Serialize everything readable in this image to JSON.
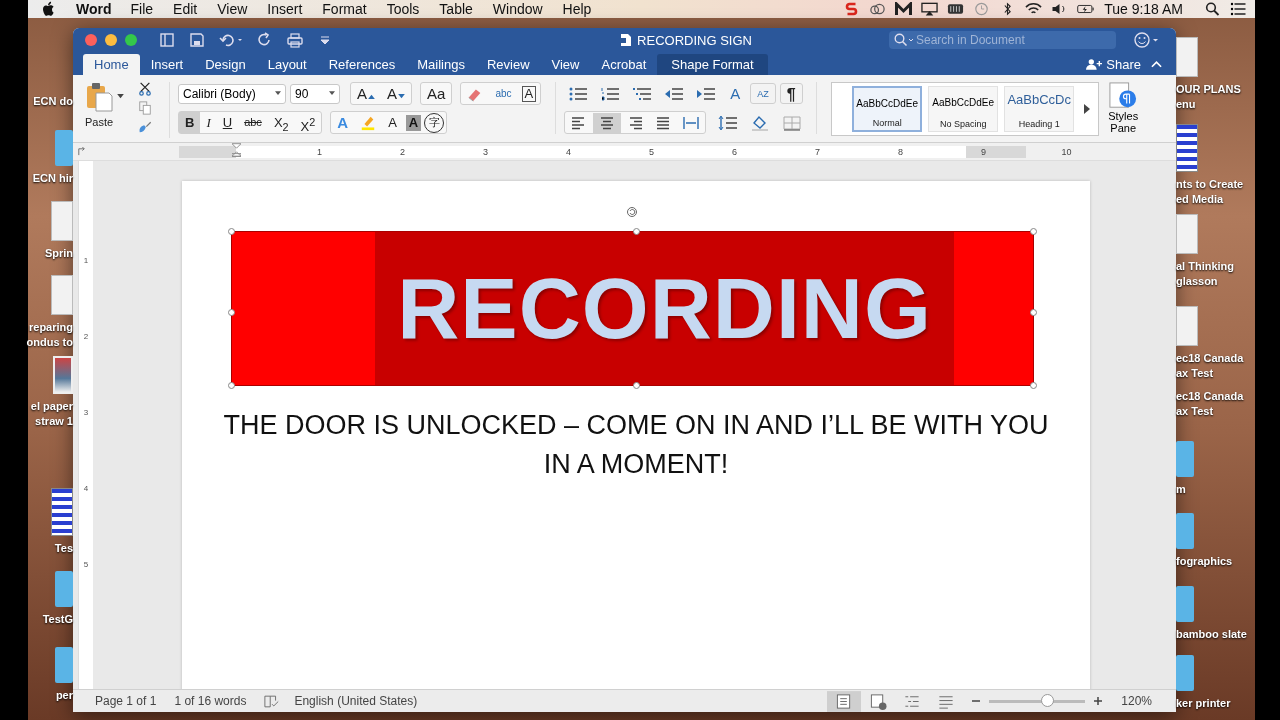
{
  "menu_bar": {
    "app": "Word",
    "items": [
      "File",
      "Edit",
      "View",
      "Insert",
      "Format",
      "Tools",
      "Table",
      "Window",
      "Help"
    ],
    "clock": "Tue 9:18 AM"
  },
  "desktop": {
    "left_items": [
      {
        "lines": [
          "ECN do"
        ]
      },
      {
        "lines": [
          "ECN hir"
        ],
        "kind": "folder"
      },
      {
        "lines": [
          "Sprin"
        ],
        "kind": "document"
      },
      {
        "lines": [
          "reparing",
          "ondus to"
        ],
        "kind": "document"
      },
      {
        "lines": [
          "el paper",
          "straw 1"
        ],
        "kind": "photo"
      },
      {
        "lines": [
          "Tes"
        ],
        "kind": "sheet"
      },
      {
        "lines": [
          "TestG"
        ],
        "kind": "folder"
      },
      {
        "lines": [
          "per"
        ],
        "kind": "folder"
      }
    ],
    "right_items": [
      {
        "lines": [
          "OUR PLANS",
          "enu"
        ],
        "kind": "document"
      },
      {
        "lines": [
          "nts to Create",
          "ed Media"
        ],
        "kind": "sheet"
      },
      {
        "lines": [
          "al Thinking",
          "glasson"
        ],
        "kind": "document"
      },
      {
        "lines": [
          "ec18 Canada",
          "ax Test"
        ],
        "kind": "document"
      },
      {
        "lines": [
          "ec18 Canada",
          "ax Test"
        ]
      },
      {
        "lines": [
          "m"
        ],
        "kind": "folder"
      },
      {
        "lines": [
          "fographics"
        ],
        "kind": "folder"
      },
      {
        "lines": [
          "bamboo slate"
        ],
        "kind": "folder"
      },
      {
        "lines": [
          "ker printer"
        ],
        "kind": "folder"
      }
    ]
  },
  "window": {
    "title": "RECORDING SIGN",
    "search": {
      "placeholder": "Search in Document"
    }
  },
  "tabs": [
    {
      "label": "Home",
      "selected": true,
      "contextual": false
    },
    {
      "label": "Insert",
      "selected": false,
      "contextual": false
    },
    {
      "label": "Design",
      "selected": false,
      "contextual": false
    },
    {
      "label": "Layout",
      "selected": false,
      "contextual": false
    },
    {
      "label": "References",
      "selected": false,
      "contextual": false
    },
    {
      "label": "Mailings",
      "selected": false,
      "contextual": false
    },
    {
      "label": "Review",
      "selected": false,
      "contextual": false
    },
    {
      "label": "View",
      "selected": false,
      "contextual": false
    },
    {
      "label": "Acrobat",
      "selected": false,
      "contextual": false
    },
    {
      "label": "Shape Format",
      "selected": false,
      "contextual": true
    }
  ],
  "share": "Share",
  "ribbon": {
    "paste": "Paste",
    "font": "Calibri (Body)",
    "size": "90",
    "font_tools": [
      "A",
      "A",
      "Aa",
      "abc",
      "A"
    ],
    "format_buttons": [
      {
        "label": "B",
        "selected": true,
        "kind": "bold"
      },
      {
        "label": "I",
        "selected": false,
        "kind": "italic"
      },
      {
        "label": "U",
        "selected": false,
        "kind": "underline"
      },
      {
        "label": "abc",
        "selected": false,
        "kind": "strike"
      },
      {
        "label": "X$_{2}$",
        "selected": false,
        "kind": "plain"
      },
      {
        "label": "X$^{2}$",
        "selected": false,
        "kind": "plain"
      }
    ],
    "effect_glyphs": [
      "A",
      "A",
      "A",
      "字"
    ],
    "para_glyphs": [
      "A",
      "AZ",
      "¶"
    ],
    "alignment": [
      {
        "selected": false
      },
      {
        "selected": true
      },
      {
        "selected": false
      },
      {
        "selected": false
      }
    ],
    "styles": [
      {
        "preview": "AaBbCcDdEe",
        "name": "Normal",
        "selected": true,
        "kind": "body"
      },
      {
        "preview": "AaBbCcDdEe",
        "name": "No Spacing",
        "selected": false,
        "kind": "body"
      },
      {
        "preview": "AaBbCcDc",
        "name": "Heading 1",
        "selected": false,
        "kind": "heading"
      }
    ],
    "styles_pane": "Styles Pane"
  },
  "ruler": {
    "marks": [
      "1",
      "2",
      "3",
      "4",
      "5",
      "6",
      "7",
      "8",
      "9",
      "10"
    ],
    "vertical_marks": [
      "1",
      "2",
      "3",
      "4",
      "5"
    ]
  },
  "document": {
    "banner": "RECORDING",
    "body": "THE DOOR IS UNLOCKED – COME ON IN AND I’LL BE WITH YOU IN A MOMENT!"
  },
  "status_bar": {
    "page": "Page 1 of 1",
    "words": "1 of 16 words",
    "language": "English (United States)",
    "zoom": "120%",
    "level": 0.6
  }
}
